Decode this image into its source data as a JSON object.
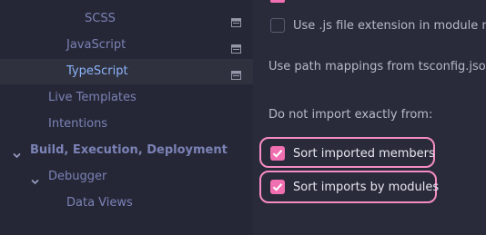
{
  "sidebar": {
    "items": [
      {
        "label": "SCSS"
      },
      {
        "label": "JavaScript"
      },
      {
        "label": "TypeScript"
      },
      {
        "label": "Live Templates"
      },
      {
        "label": "Intentions"
      },
      {
        "label": "Build, Execution, Deployment"
      },
      {
        "label": "Debugger"
      },
      {
        "label": "Data Views"
      }
    ]
  },
  "content": {
    "js_extension_label": "Use .js file extension in module name",
    "path_mappings_label": "Use path mappings from tsconfig.json:",
    "do_not_import_label": "Do not import exactly from:",
    "sort_members_label": "Sort imported members",
    "sort_modules_label": "Sort imports by modules"
  },
  "colors": {
    "accent": "#f06fb0",
    "focus_ring": "#f48cc4",
    "sidebar_bg": "#262736",
    "content_bg": "#2a2b3a",
    "tree_text": "#7b82b5",
    "selected_text": "#8ab4f8"
  },
  "icons": [
    "project-settings-icon",
    "chevron-down-icon",
    "checkmark-icon"
  ]
}
